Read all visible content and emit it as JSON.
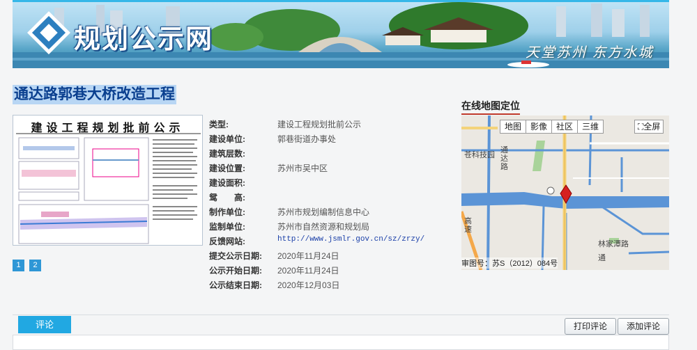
{
  "banner": {
    "site_title": "规划公示网",
    "slogan": "天堂苏州  东方水城"
  },
  "page_title": "通达路郭巷大桥改造工程",
  "thumbnail": {
    "doc_title": "建设工程规划批前公示",
    "pages": [
      "1",
      "2"
    ]
  },
  "info": [
    {
      "label": "类型:",
      "value": "建设工程规划批前公示"
    },
    {
      "label": "建设单位:",
      "value": "郭巷街道办事处"
    },
    {
      "label": "建筑层数:",
      "value": ""
    },
    {
      "label": "建设位置:",
      "value": "苏州市吴中区"
    },
    {
      "label": "建设面积:",
      "value": ""
    },
    {
      "label": "鸳　　高:",
      "value": ""
    },
    {
      "label": "制作单位:",
      "value": "苏州市规划编制信息中心"
    },
    {
      "label": "监制单位:",
      "value": "苏州市自然资源和规划局"
    },
    {
      "label": "反馈网站:",
      "value": "http://www.jsmlr.gov.cn/sz/zrzy/"
    },
    {
      "label": "提交公示日期:",
      "value": "2020年11月24日"
    },
    {
      "label": "公示开始日期:",
      "value": "2020年11月24日"
    },
    {
      "label": "公示结束日期:",
      "value": "2020年12月03日"
    }
  ],
  "map": {
    "heading": "在线地图定位",
    "controls": [
      "地图",
      "影像",
      "社区",
      "三维"
    ],
    "fullscreen": "全屏",
    "labels": {
      "school": "苍科技园",
      "road1": "通达路",
      "road2": "高速",
      "village": "林家潭路",
      "road3": "通"
    },
    "credit": "审图号：苏S（2012）084号"
  },
  "bottom": {
    "comment_tab": "评论",
    "print_button": "打印评论",
    "add_button": "添加评论"
  },
  "colors": {
    "accent": "#21a8e2",
    "title_blue": "#0a3f8f",
    "water": "#5b94d6"
  }
}
